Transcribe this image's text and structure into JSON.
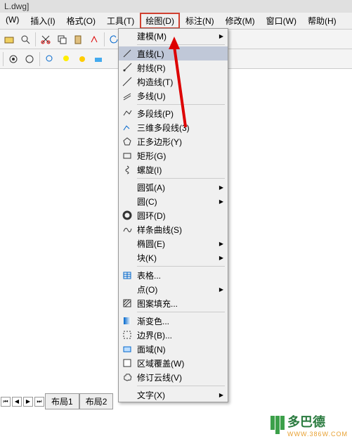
{
  "title": "L.dwg]",
  "menu": {
    "items": [
      "(W)",
      "插入(I)",
      "格式(O)",
      "工具(T)",
      "绘图(D)",
      "标注(N)",
      "修改(M)",
      "窗口(W)",
      "帮助(H)"
    ]
  },
  "dropdown": {
    "items": [
      {
        "label": "建模(M)",
        "icon": "",
        "submenu": true
      },
      {
        "sep": true
      },
      {
        "label": "直线(L)",
        "icon": "line",
        "highlighted": true
      },
      {
        "label": "射线(R)",
        "icon": "ray"
      },
      {
        "label": "构造线(T)",
        "icon": "xline"
      },
      {
        "label": "多线(U)",
        "icon": "mline"
      },
      {
        "sep": true
      },
      {
        "label": "多段线(P)",
        "icon": "pline"
      },
      {
        "label": "三维多段线(3)",
        "icon": "pline3d"
      },
      {
        "label": "正多边形(Y)",
        "icon": "polygon"
      },
      {
        "label": "矩形(G)",
        "icon": "rect"
      },
      {
        "label": "螺旋(I)",
        "icon": "helix"
      },
      {
        "sep": true
      },
      {
        "label": "圆弧(A)",
        "icon": "",
        "submenu": true
      },
      {
        "label": "圆(C)",
        "icon": "",
        "submenu": true
      },
      {
        "label": "圆环(D)",
        "icon": "donut"
      },
      {
        "label": "样条曲线(S)",
        "icon": "spline"
      },
      {
        "label": "椭圆(E)",
        "icon": "",
        "submenu": true
      },
      {
        "label": "块(K)",
        "icon": "",
        "submenu": true
      },
      {
        "sep": true
      },
      {
        "label": "表格...",
        "icon": "table"
      },
      {
        "label": "点(O)",
        "icon": "",
        "submenu": true
      },
      {
        "label": "图案填充...",
        "icon": "hatch"
      },
      {
        "sep": true
      },
      {
        "label": "渐变色...",
        "icon": "gradient"
      },
      {
        "label": "边界(B)...",
        "icon": "boundary"
      },
      {
        "label": "面域(N)",
        "icon": "region"
      },
      {
        "label": "区域覆盖(W)",
        "icon": "wipeout"
      },
      {
        "label": "修订云线(V)",
        "icon": "revcloud"
      },
      {
        "sep": true
      },
      {
        "label": "文字(X)",
        "icon": "",
        "submenu": true
      }
    ]
  },
  "tabs": {
    "nav": [
      "⏮",
      "◀",
      "▶",
      "⏭"
    ],
    "items": [
      "布局1",
      "布局2"
    ]
  },
  "logo": {
    "text": "多巴德",
    "sub": "WWW.386W.COM"
  },
  "colors": {
    "highlight_box": "#d04030",
    "arrow": "#d00000",
    "menu_hover": "#c0c8d8"
  }
}
